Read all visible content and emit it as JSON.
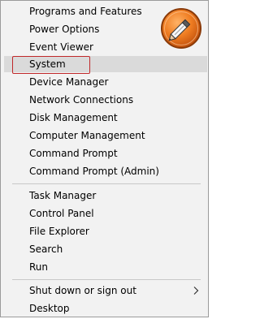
{
  "menu": {
    "items": [
      {
        "label": "Programs and Features"
      },
      {
        "label": "Power Options"
      },
      {
        "label": "Event Viewer"
      },
      {
        "label": "System"
      },
      {
        "label": "Device Manager"
      },
      {
        "label": "Network Connections"
      },
      {
        "label": "Disk Management"
      },
      {
        "label": "Computer Management"
      },
      {
        "label": "Command Prompt"
      },
      {
        "label": "Command Prompt (Admin)"
      },
      {
        "label": "Task Manager"
      },
      {
        "label": "Control Panel"
      },
      {
        "label": "File Explorer"
      },
      {
        "label": "Search"
      },
      {
        "label": "Run"
      },
      {
        "label": "Shut down or sign out"
      },
      {
        "label": "Desktop"
      }
    ],
    "highlighted_label": "System",
    "submenu_icon": "chevron-right-icon"
  },
  "colors": {
    "menu_background": "#f2f2f2",
    "highlight": "#dadada",
    "annotation": "#c0282a",
    "logo_orange": "#ef7d22"
  },
  "logo_icon": "pencil-logo-icon"
}
